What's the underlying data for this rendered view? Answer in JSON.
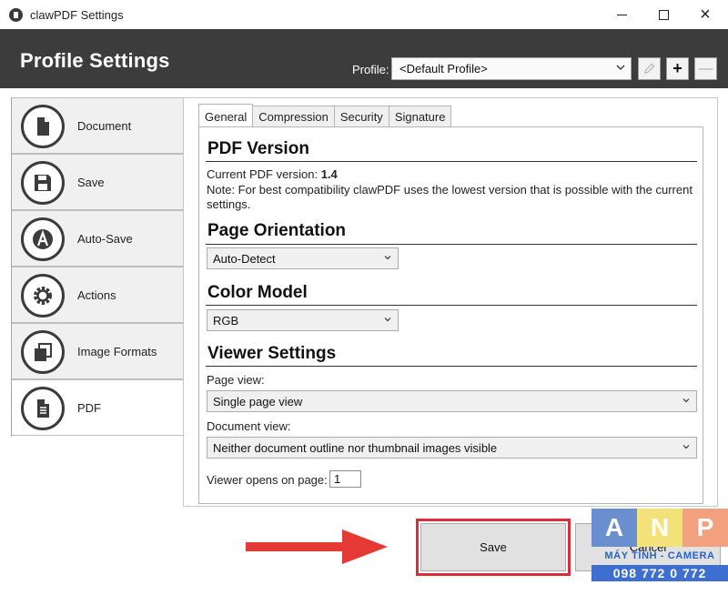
{
  "window": {
    "title": "clawPDF Settings"
  },
  "header": {
    "title": "Profile Settings",
    "profile_label": "Profile:",
    "profile_value": "<Default Profile>",
    "add_symbol": "+",
    "remove_symbol": "—"
  },
  "sidebar": {
    "items": [
      {
        "label": "Document",
        "icon": "document-icon"
      },
      {
        "label": "Save",
        "icon": "save-icon"
      },
      {
        "label": "Auto-Save",
        "icon": "auto-save-icon"
      },
      {
        "label": "Actions",
        "icon": "gear-icon"
      },
      {
        "label": "Image Formats",
        "icon": "image-formats-icon"
      },
      {
        "label": "PDF",
        "icon": "pdf-icon"
      }
    ],
    "active": "PDF"
  },
  "tabs": [
    {
      "label": "General",
      "active": true
    },
    {
      "label": "Compression",
      "active": false
    },
    {
      "label": "Security",
      "active": false
    },
    {
      "label": "Signature",
      "active": false
    }
  ],
  "general": {
    "pdf_version": {
      "title": "PDF Version",
      "current_label": "Current PDF version:",
      "current_value": "1.4",
      "note_line1": "Note: For best compatibility clawPDF uses the lowest version that is possible with the current",
      "note_line2": "settings."
    },
    "page_orientation": {
      "title": "Page Orientation",
      "value": "Auto-Detect"
    },
    "color_model": {
      "title": "Color Model",
      "value": "RGB"
    },
    "viewer_settings": {
      "title": "Viewer Settings",
      "page_view_label": "Page view:",
      "page_view_value": "Single page view",
      "document_view_label": "Document view:",
      "document_view_value": "Neither document outline nor thumbnail images visible",
      "opens_on_page_label": "Viewer opens on page:",
      "opens_on_page_value": "1"
    }
  },
  "buttons": {
    "save": "Save",
    "cancel": "Cancel"
  },
  "watermark": {
    "letters": [
      "A",
      "N",
      "P"
    ],
    "subtitle": "MÁY TÍNH - CAMERA",
    "phone": "098 772 0 772"
  },
  "colors": {
    "header_bg": "#3c3c3c",
    "highlight": "#d8303a",
    "arrow": "#e53935"
  }
}
